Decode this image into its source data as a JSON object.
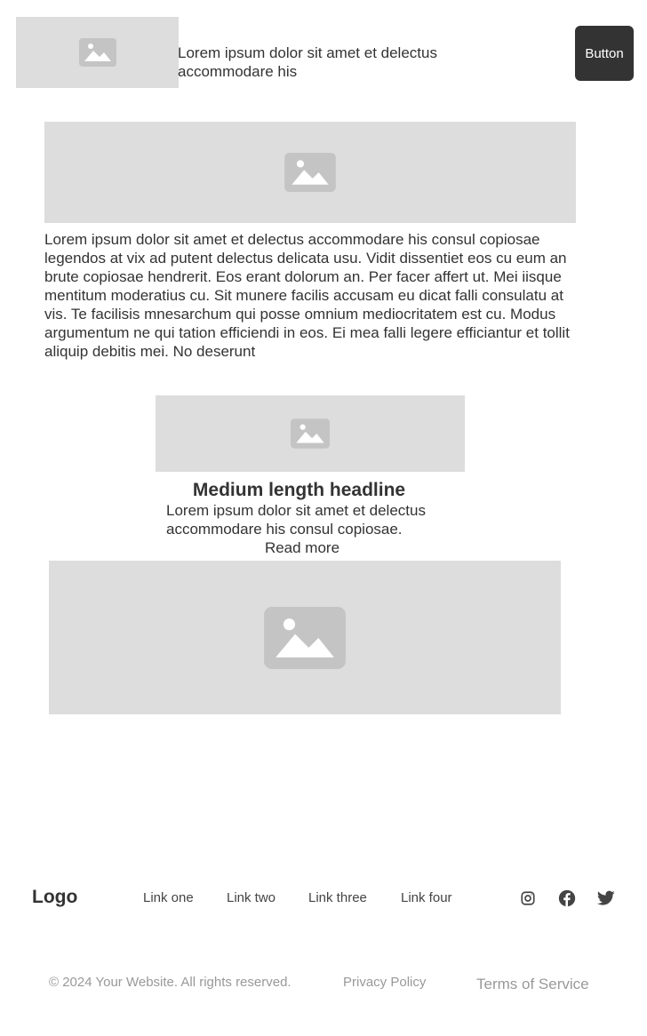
{
  "header": {
    "image_icon": "image-placeholder-icon",
    "text": "Lorem ipsum dolor sit amet et delectus accommodare his",
    "button_label": "Button"
  },
  "main": {
    "banner_icon": "image-placeholder-icon",
    "paragraph": "Lorem ipsum dolor sit amet et delectus accommodare his consul copiosae legendos at vix ad putent delectus delicata usu. Vidit dissentiet eos cu eum an brute copiosae hendrerit. Eos erant dolorum an. Per facer affert ut. Mei iisque mentitum moderatius cu. Sit munere facilis accusam eu dicat falli consulatu at vis. Te facilisis mnesarchum qui posse omnium mediocritatem est cu. Modus argumentum ne qui tation efficiendi in eos. Ei mea falli legere efficiantur et tollit aliquip debitis mei. No deserunt"
  },
  "card": {
    "image_icon": "image-placeholder-icon",
    "headline": "Medium length headline",
    "text": "Lorem ipsum dolor sit amet et delectus accommodare his consul copiosae.",
    "link": "Read more"
  },
  "large_image_icon": "image-placeholder-icon",
  "footer": {
    "logo": "Logo",
    "links": [
      "Link one",
      "Link two",
      "Link three",
      "Link four"
    ],
    "social": [
      "instagram-icon",
      "facebook-icon",
      "twitter-icon"
    ],
    "copyright": "© 2024 Your Website. All rights reserved.",
    "privacy": "Privacy Policy",
    "terms": "Terms of Service"
  },
  "colors": {
    "placeholder_bg": "#dddddd",
    "placeholder_icon": "#c4c4c4",
    "button_bg": "#333333",
    "text": "#333333",
    "muted_text": "#999999"
  }
}
